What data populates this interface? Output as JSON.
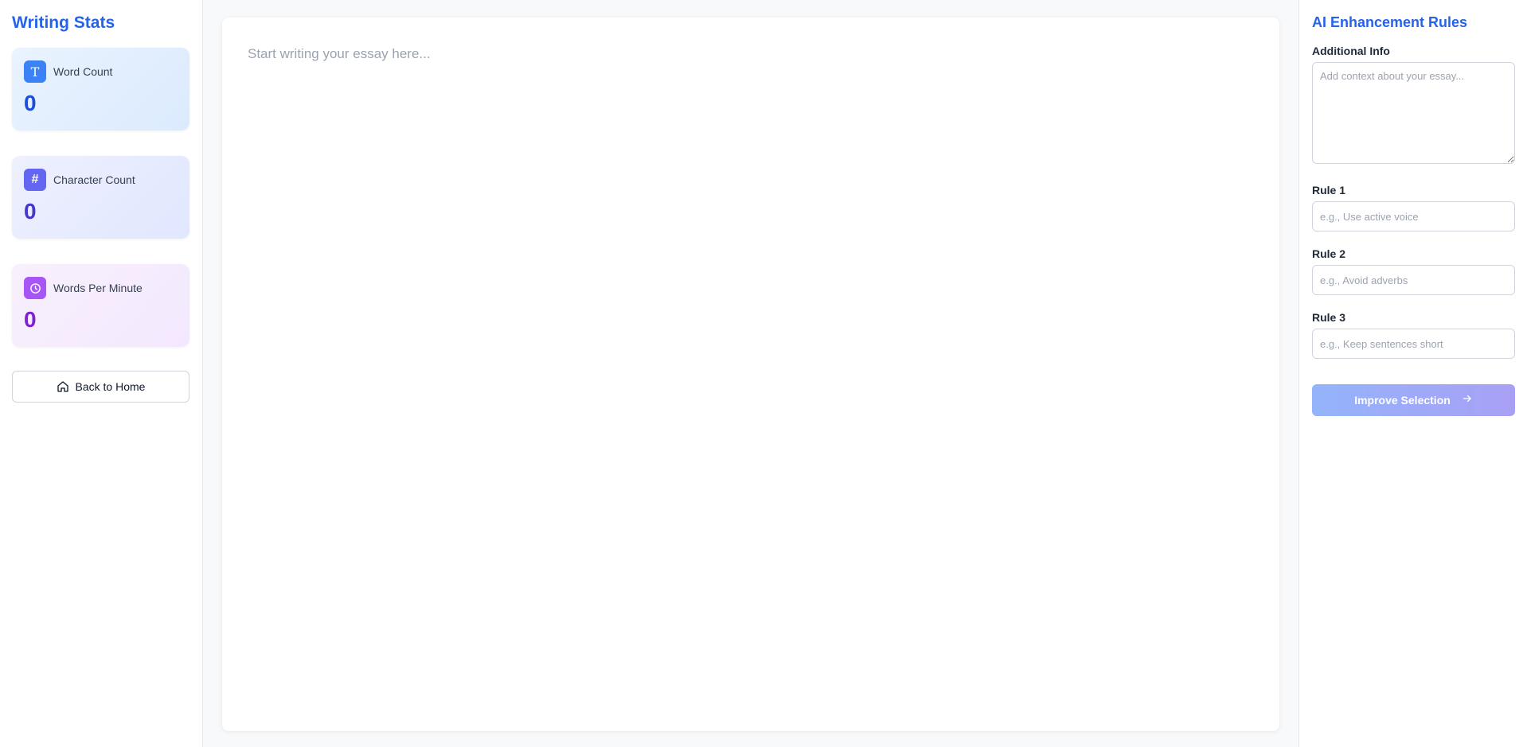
{
  "left_sidebar": {
    "title": "Writing Stats",
    "stats": [
      {
        "label": "Word Count",
        "value": "0",
        "icon": "type-icon"
      },
      {
        "label": "Character Count",
        "value": "0",
        "icon": "hash-icon"
      },
      {
        "label": "Words Per Minute",
        "value": "0",
        "icon": "clock-icon"
      }
    ],
    "back_button_label": "Back to Home"
  },
  "editor": {
    "placeholder": "Start writing your essay here...",
    "value": ""
  },
  "right_sidebar": {
    "title": "AI Enhancement Rules",
    "additional_info": {
      "label": "Additional Info",
      "placeholder": "Add context about your essay...",
      "value": ""
    },
    "rules": [
      {
        "label": "Rule 1",
        "placeholder": "e.g., Use active voice",
        "value": ""
      },
      {
        "label": "Rule 2",
        "placeholder": "e.g., Avoid adverbs",
        "value": ""
      },
      {
        "label": "Rule 3",
        "placeholder": "e.g., Keep sentences short",
        "value": ""
      }
    ],
    "improve_button_label": "Improve Selection",
    "improve_button_enabled": false
  },
  "colors": {
    "accent": "#2563eb",
    "word_icon": "#3b82f6",
    "char_icon": "#6366f1",
    "wpm_icon": "#a855f7"
  }
}
